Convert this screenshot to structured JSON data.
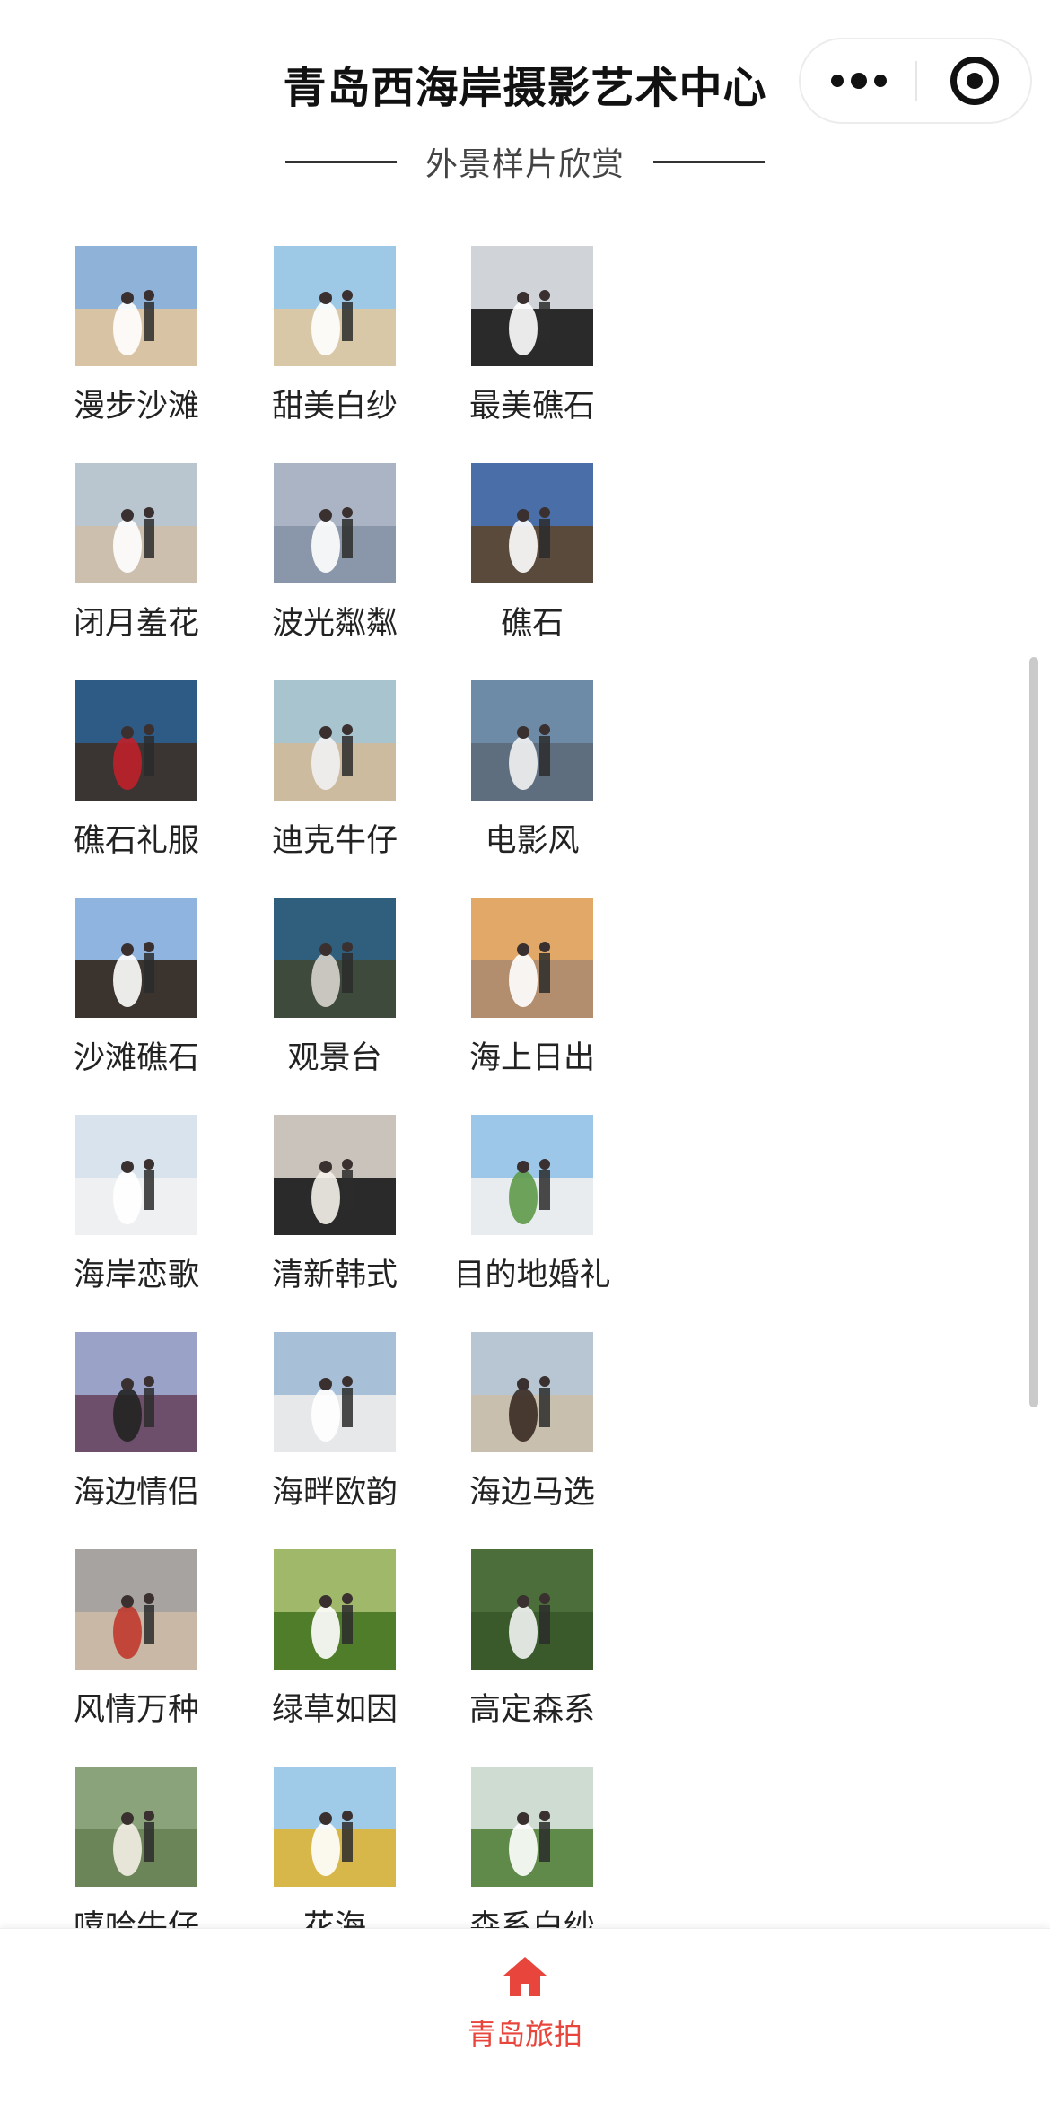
{
  "header": {
    "title": "青岛西海岸摄影艺术中心",
    "subtitle": "外景样片欣赏",
    "more_icon": "more-dots-icon",
    "close_icon": "target-close-icon"
  },
  "gallery": {
    "items": [
      {
        "label": "漫步沙滩",
        "sky": "#8fb2d8",
        "ground": "#d9c3a5",
        "accent": "#ffffff"
      },
      {
        "label": "甜美白纱",
        "sky": "#9dc8e6",
        "ground": "#d8c8a8",
        "accent": "#ffffff"
      },
      {
        "label": "最美礁石",
        "sky": "#d0d4d8",
        "ground": "#2a2a2a",
        "accent": "#ffffff"
      },
      {
        "label": "闭月羞花",
        "sky": "#b9c6d0",
        "ground": "#cdbfae",
        "accent": "#ffffff"
      },
      {
        "label": "波光粼粼",
        "sky": "#aab4c4",
        "ground": "#8a97aa",
        "accent": "#ffffff"
      },
      {
        "label": "礁石",
        "sky": "#4a6ea8",
        "ground": "#5a4a3c",
        "accent": "#ffffff"
      },
      {
        "label": "礁石礼服",
        "sky": "#2e5a86",
        "ground": "#3a3432",
        "accent": "#c0202a"
      },
      {
        "label": "迪克牛仔",
        "sky": "#a8c4cf",
        "ground": "#cdbba0",
        "accent": "#f2f2f2"
      },
      {
        "label": "电影风",
        "sky": "#6d8ba6",
        "ground": "#5e6e7e",
        "accent": "#f2f2f2"
      },
      {
        "label": "沙滩礁石",
        "sky": "#8fb4e0",
        "ground": "#3b342e",
        "accent": "#ffffff"
      },
      {
        "label": "观景台",
        "sky": "#2f5f7d",
        "ground": "#3d4a3c",
        "accent": "#d7d4cc"
      },
      {
        "label": "海上日出",
        "sky": "#e2a868",
        "ground": "#b38e6e",
        "accent": "#ffffff"
      },
      {
        "label": "海岸恋歌",
        "sky": "#d9e3ee",
        "ground": "#eef0f2",
        "accent": "#ffffff"
      },
      {
        "label": "清新韩式",
        "sky": "#c9c3bb",
        "ground": "#2a2a2a",
        "accent": "#f5f1ea"
      },
      {
        "label": "目的地婚礼",
        "sky": "#9cc7e8",
        "ground": "#e8ecef",
        "accent": "#5f9a4a"
      },
      {
        "label": "海边情侣",
        "sky": "#9aa2c8",
        "ground": "#6d4f6c",
        "accent": "#222222"
      },
      {
        "label": "海畔欧韵",
        "sky": "#a8bfd8",
        "ground": "#e6e8ea",
        "accent": "#ffffff"
      },
      {
        "label": "海边马选",
        "sky": "#b7c6d2",
        "ground": "#c8bfae",
        "accent": "#3a2a22"
      },
      {
        "label": "风情万种",
        "sky": "#a6a3a1",
        "ground": "#c9b8a6",
        "accent": "#c03a2e"
      },
      {
        "label": "绿草如因",
        "sky": "#9fb86a",
        "ground": "#4f7d2a",
        "accent": "#ffffff"
      },
      {
        "label": "高定森系",
        "sky": "#4b6e3a",
        "ground": "#3b5a2c",
        "accent": "#f3f3f3"
      },
      {
        "label": "嘻哈牛仔",
        "sky": "#8aa37a",
        "ground": "#6b8458",
        "accent": "#f4efe6"
      },
      {
        "label": "花海",
        "sky": "#9fcbe9",
        "ground": "#d8b74a",
        "accent": "#ffffff"
      },
      {
        "label": "森系白纱",
        "sky": "#cfdcd2",
        "ground": "#5f8a4a",
        "accent": "#ffffff"
      }
    ]
  },
  "tabbar": {
    "home_label": "青岛旅拍",
    "home_icon": "home-icon",
    "accent": "#e8453c"
  }
}
